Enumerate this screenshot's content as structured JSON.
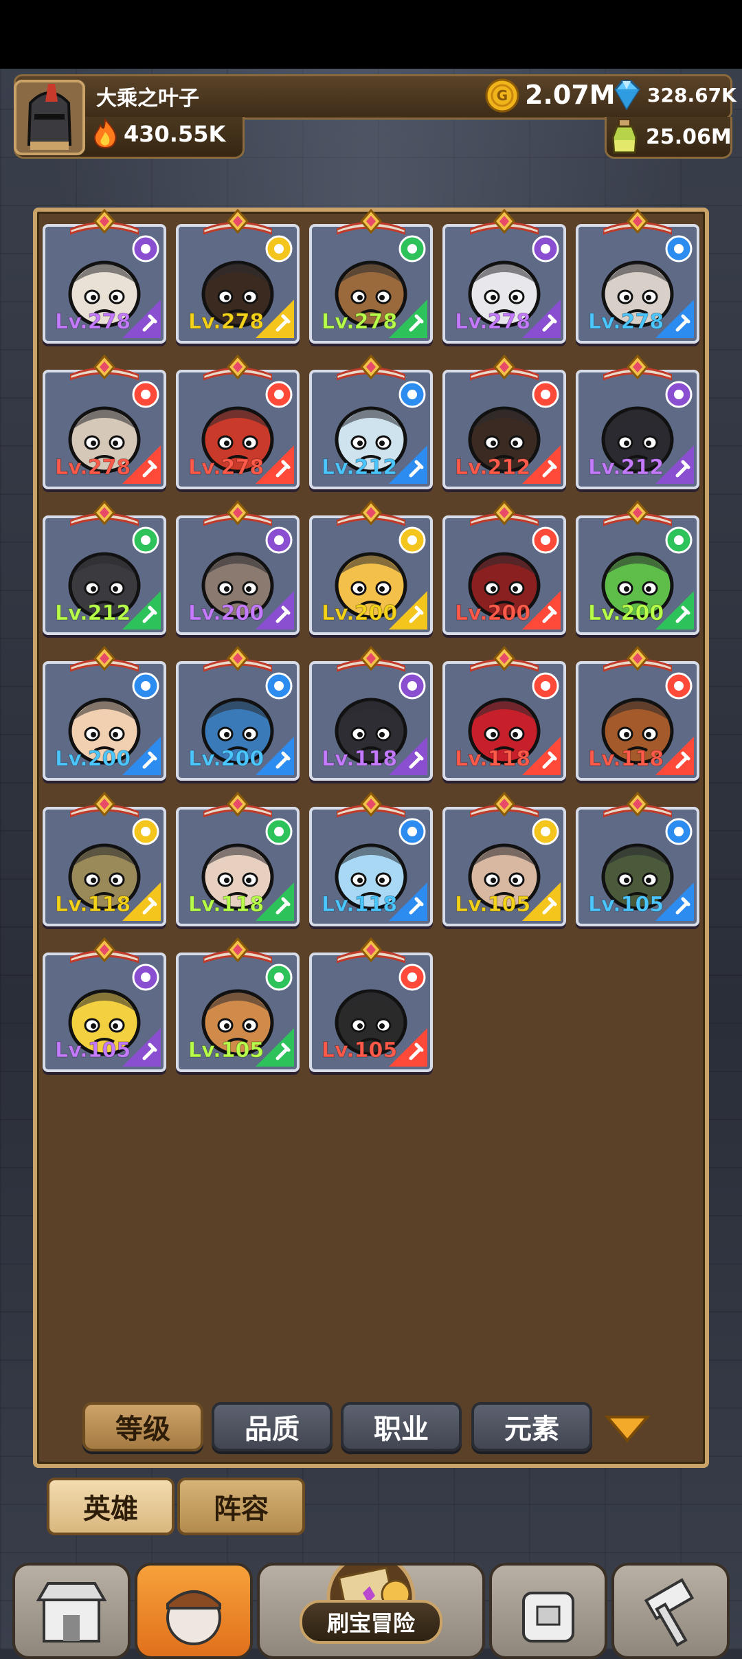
{
  "player": {
    "name": "大乘之叶子",
    "power": "430.55K"
  },
  "resources": {
    "gold": "2.07M",
    "gems": "328.67K",
    "potion": "25.06M"
  },
  "colors": {
    "light": "#f4c51c",
    "dark": "#8a4fd0",
    "wind": "#2ec25a",
    "water": "#2d8cf0",
    "fire": "#ff4a3a",
    "lv_yellow": "#f4d21a",
    "lv_purple": "#c57bff",
    "lv_green": "#b7ff4a",
    "lv_blue": "#4cc6ff",
    "lv_red": "#ff5a4a"
  },
  "heroes": [
    {
      "level": "Lv.278",
      "element": "dark",
      "cls": "wand"
    },
    {
      "level": "Lv.278",
      "element": "light",
      "cls": "wand"
    },
    {
      "level": "Lv.278",
      "element": "wind",
      "cls": "wand"
    },
    {
      "level": "Lv.278",
      "element": "dark",
      "cls": "wand"
    },
    {
      "level": "Lv.278",
      "element": "water",
      "cls": "wand"
    },
    {
      "level": "Lv.278",
      "element": "fire",
      "cls": "wand"
    },
    {
      "level": "Lv.278",
      "element": "fire",
      "cls": "wand"
    },
    {
      "level": "Lv.212",
      "element": "water",
      "cls": "shield"
    },
    {
      "level": "Lv.212",
      "element": "fire",
      "cls": "shield"
    },
    {
      "level": "Lv.212",
      "element": "dark",
      "cls": "shield"
    },
    {
      "level": "Lv.212",
      "element": "wind",
      "cls": "shield"
    },
    {
      "level": "Lv.200",
      "element": "dark",
      "cls": "swords"
    },
    {
      "level": "Lv.200",
      "element": "light",
      "cls": "swords"
    },
    {
      "level": "Lv.200",
      "element": "fire",
      "cls": "swords"
    },
    {
      "level": "Lv.200",
      "element": "wind",
      "cls": "swords"
    },
    {
      "level": "Lv.200",
      "element": "water",
      "cls": "swords"
    },
    {
      "level": "Lv.200",
      "element": "water",
      "cls": "swords"
    },
    {
      "level": "Lv.118",
      "element": "dark",
      "cls": "sword"
    },
    {
      "level": "Lv.118",
      "element": "fire",
      "cls": "sword"
    },
    {
      "level": "Lv.118",
      "element": "fire",
      "cls": "sword"
    },
    {
      "level": "Lv.118",
      "element": "light",
      "cls": "sword"
    },
    {
      "level": "Lv.118",
      "element": "wind",
      "cls": "sword"
    },
    {
      "level": "Lv.118",
      "element": "water",
      "cls": "sword"
    },
    {
      "level": "Lv.105",
      "element": "light",
      "cls": "bow"
    },
    {
      "level": "Lv.105",
      "element": "water",
      "cls": "bow"
    },
    {
      "level": "Lv.105",
      "element": "dark",
      "cls": "bow"
    },
    {
      "level": "Lv.105",
      "element": "wind",
      "cls": "bow"
    },
    {
      "level": "Lv.105",
      "element": "fire",
      "cls": "bow"
    }
  ],
  "sort_tabs": [
    "等级",
    "品质",
    "职业",
    "元素"
  ],
  "sub_tabs": {
    "heroes": "英雄",
    "lineup": "阵容"
  },
  "bottom_nav": {
    "adventure_label": "刷宝冒险"
  }
}
